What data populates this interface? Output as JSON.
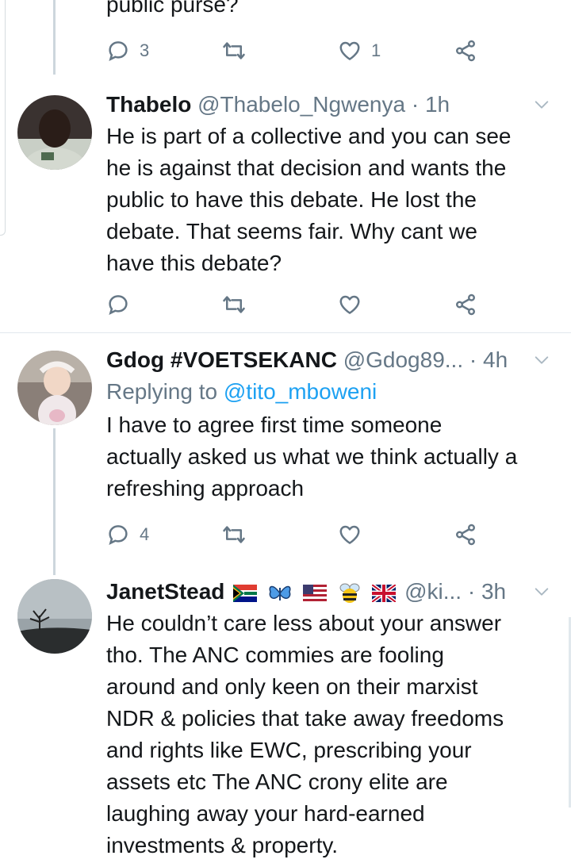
{
  "colors": {
    "accent": "#1da1f2",
    "secondary": "#657786",
    "text": "#14171a",
    "divider": "#e1e8ed"
  },
  "prev_tweet": {
    "text_tail": "public purse?",
    "reply_count": "3",
    "retweet_count": "",
    "like_count": "1"
  },
  "tweets": [
    {
      "name": "Thabelo",
      "handle": "@Thabelo_Ngwenya",
      "dot": "·",
      "time": "1h",
      "lines": [
        "He is part of a collective and you can see",
        "he is against that decision and wants the",
        "public to have this debate. He lost the",
        "debate. That seems fair. Why cant we",
        "have this debate?"
      ],
      "reply_count": "",
      "like_count": ""
    },
    {
      "name": "Gdog #VOETSEKANC",
      "handle": "@Gdog89...",
      "dot": "·",
      "time": "4h",
      "replying_prefix": "Replying to",
      "replying_to": "@tito_mboweni",
      "lines": [
        "I have to agree first time someone",
        "actually asked us what we think actually a",
        "refreshing approach"
      ],
      "reply_count": "4",
      "like_count": ""
    },
    {
      "name": "JanetStead",
      "emoji": [
        "south-africa-flag",
        "butterfly",
        "us-flag",
        "bee",
        "uk-flag"
      ],
      "handle": "@ki...",
      "dot": "·",
      "time": "3h",
      "lines": [
        "He couldn’t care less about your answer",
        "tho. The ANC commies are fooling",
        "around and only keen on their marxist",
        "NDR & policies that take away freedoms",
        "and rights like EWC, prescribing your",
        "assets etc The ANC crony elite are",
        "laughing away your hard-earned",
        "investments & property."
      ]
    }
  ]
}
